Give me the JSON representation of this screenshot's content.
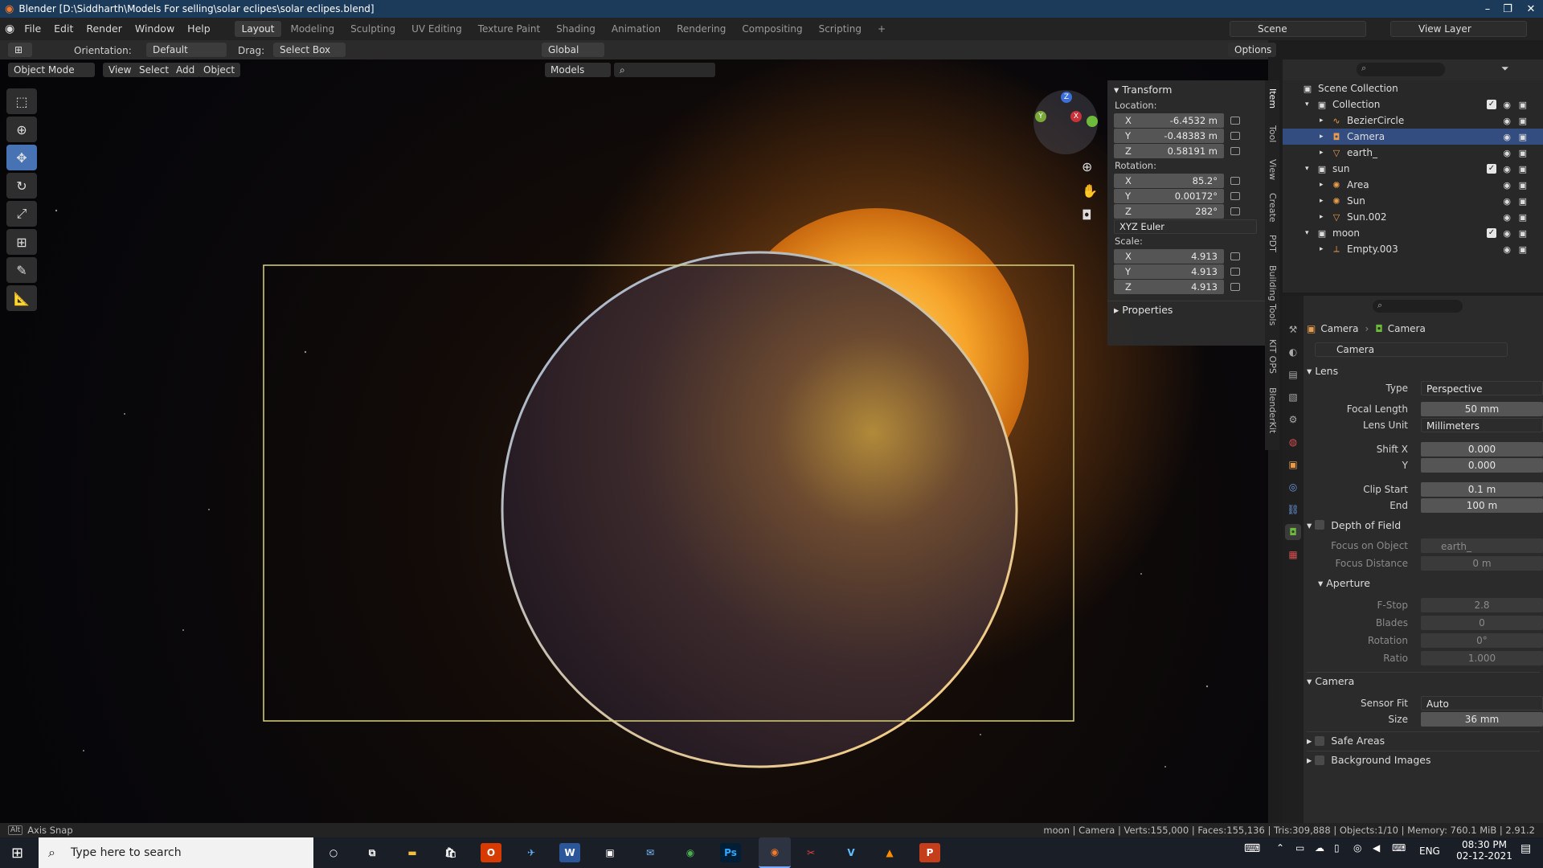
{
  "window": {
    "title": "Blender [D:\\Siddharth\\Models For selling\\solar eclipes\\solar eclipes.blend]",
    "minimize": "–",
    "maximize": "❐",
    "close": "✕"
  },
  "menus": [
    "File",
    "Edit",
    "Render",
    "Window",
    "Help"
  ],
  "workspaces": [
    "Layout",
    "Modeling",
    "Sculpting",
    "UV Editing",
    "Texture Paint",
    "Shading",
    "Animation",
    "Rendering",
    "Compositing",
    "Scripting",
    "+"
  ],
  "active_workspace": "Layout",
  "scene": "Scene",
  "view_layer": "View Layer",
  "tool_header": {
    "orientation_label": "Orientation:",
    "orientation": "Default",
    "drag_label": "Drag:",
    "drag": "Select Box",
    "transform": "Global",
    "options": "Options"
  },
  "viewport_header": {
    "mode": "Object Mode",
    "view": "View",
    "select": "Select",
    "add": "Add",
    "object": "Object",
    "collection": "Models"
  },
  "gizmo": {
    "x": "X",
    "y": "Y",
    "z": "Z"
  },
  "npanel": {
    "transform": "Transform",
    "location_label": "Location:",
    "location": [
      {
        "axis": "X",
        "value": "-6.4532 m"
      },
      {
        "axis": "Y",
        "value": "-0.48383 m"
      },
      {
        "axis": "Z",
        "value": "0.58191 m"
      }
    ],
    "rotation_label": "Rotation:",
    "rotation": [
      {
        "axis": "X",
        "value": "85.2°"
      },
      {
        "axis": "Y",
        "value": "0.00172°"
      },
      {
        "axis": "Z",
        "value": "282°"
      }
    ],
    "rotation_mode": "XYZ Euler",
    "scale_label": "Scale:",
    "scale": [
      {
        "axis": "X",
        "value": "4.913"
      },
      {
        "axis": "Y",
        "value": "4.913"
      },
      {
        "axis": "Z",
        "value": "4.913"
      }
    ],
    "properties": "Properties"
  },
  "side_tabs": [
    "Item",
    "Tool",
    "View",
    "Create",
    "PDT",
    "Building Tools",
    "KIT OPS",
    "BlenderKit"
  ],
  "outliner": {
    "root": "Scene Collection",
    "rows": [
      {
        "name": "Collection",
        "level": 1,
        "type": "collection",
        "checked": true
      },
      {
        "name": "BezierCircle",
        "level": 2,
        "type": "curve"
      },
      {
        "name": "Camera",
        "level": 2,
        "type": "camera",
        "selected": true
      },
      {
        "name": "earth_",
        "level": 2,
        "type": "mesh"
      },
      {
        "name": "sun",
        "level": 1,
        "type": "collection",
        "checked": true
      },
      {
        "name": "Area",
        "level": 2,
        "type": "light"
      },
      {
        "name": "Sun",
        "level": 2,
        "type": "light"
      },
      {
        "name": "Sun.002",
        "level": 2,
        "type": "mesh"
      },
      {
        "name": "moon",
        "level": 1,
        "type": "collection",
        "checked": true
      },
      {
        "name": "Empty.003",
        "level": 2,
        "type": "empty"
      }
    ]
  },
  "properties": {
    "breadcrumb_object": "Camera",
    "breadcrumb_data": "Camera",
    "datablock": "Camera",
    "lens_section": "Lens",
    "type_label": "Type",
    "type": "Perspective",
    "focal_label": "Focal Length",
    "focal": "50 mm",
    "lens_unit_label": "Lens Unit",
    "lens_unit": "Millimeters",
    "shift_x_label": "Shift X",
    "shift_x": "0.000",
    "shift_y_label": "Y",
    "shift_y": "0.000",
    "clip_start_label": "Clip Start",
    "clip_start": "0.1 m",
    "clip_end_label": "End",
    "clip_end": "100 m",
    "dof_section": "Depth of Field",
    "focus_obj_label": "Focus on Object",
    "focus_obj": "earth_",
    "focus_dist_label": "Focus Distance",
    "focus_dist": "0 m",
    "aperture_section": "Aperture",
    "fstop_label": "F-Stop",
    "fstop": "2.8",
    "blades_label": "Blades",
    "blades": "0",
    "rotation_label": "Rotation",
    "rotation": "0°",
    "ratio_label": "Ratio",
    "ratio": "1.000",
    "camera_section": "Camera",
    "sensor_fit_label": "Sensor Fit",
    "sensor_fit": "Auto",
    "size_label": "Size",
    "size": "36 mm",
    "safe_areas": "Safe Areas",
    "background_images": "Background Images"
  },
  "status": {
    "key": "Alt",
    "hint": "Axis Snap",
    "stats": "moon | Camera | Verts:155,000 | Faces:155,136 | Tris:309,888 | Objects:1/10 | Memory: 760.1 MiB | 2.91.2"
  },
  "taskbar": {
    "search_placeholder": "Type here to search",
    "lang": "ENG",
    "time": "08:30 PM",
    "date": "02-12-2021",
    "apps": [
      "Ps",
      "W",
      "P"
    ]
  }
}
